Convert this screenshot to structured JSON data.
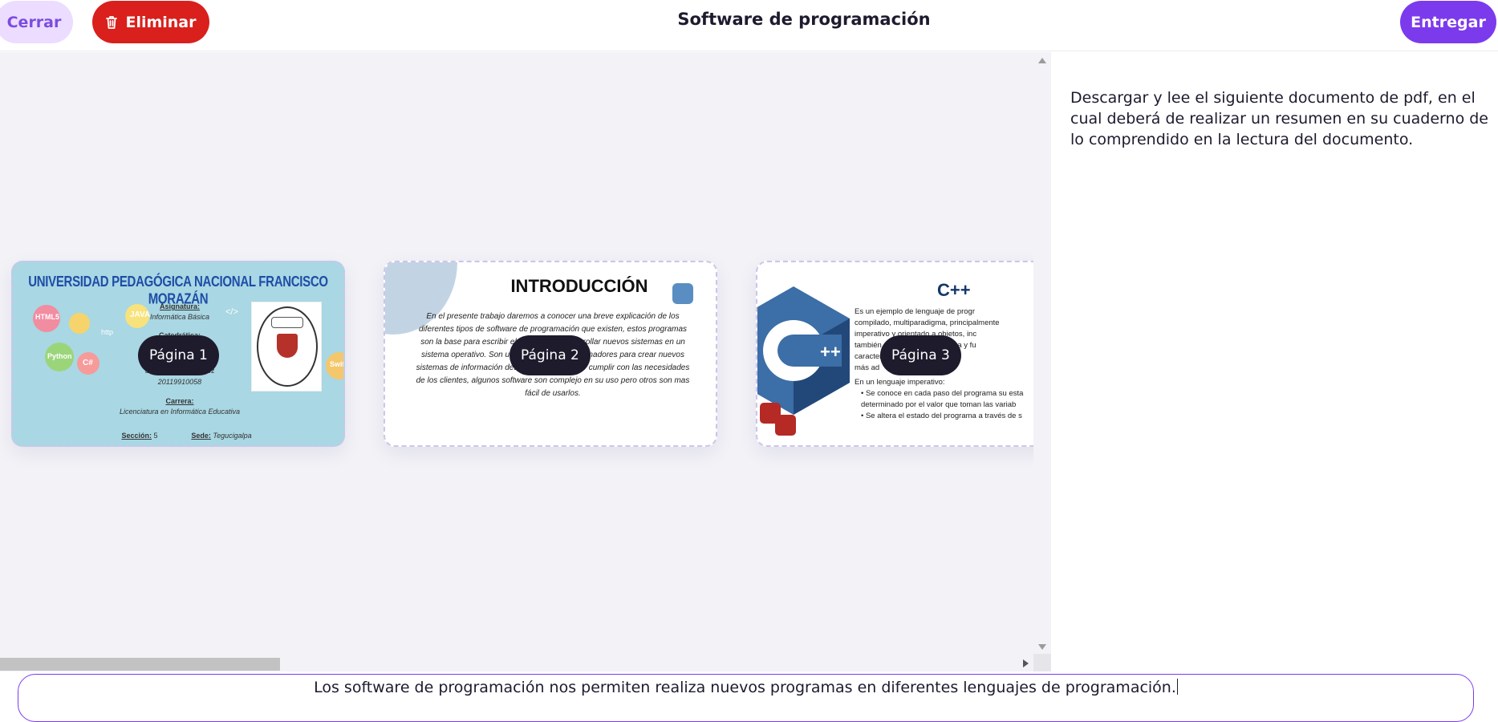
{
  "header": {
    "close_label": "Cerrar",
    "delete_label": "Eliminar",
    "title": "Software de programación",
    "submit_label": "Entregar"
  },
  "pages": [
    {
      "label": "Página 1",
      "thumbnail": {
        "university": "UNIVERSIDAD PEDAGÓGICA NACIONAL FRANCISCO MORAZÁN",
        "subject_label": "Asignatura:",
        "subject": "Informática Básica",
        "professor_label": "Catedrática:",
        "student": "Samuel ... Hernández",
        "account": "20119910058",
        "career_label": "Carrera:",
        "career": "Licenciatura en Informática Educativa",
        "section_label": "Sección:",
        "section": "5",
        "campus_label": "Sede:",
        "campus": "Tegucigalpa",
        "bubble_words": [
          "HTML5",
          "JAVA",
          "Python",
          "C#",
          "Swift",
          "http",
          "</>"
        ]
      }
    },
    {
      "label": "Página 2",
      "thumbnail": {
        "heading": "INTRODUCCIÓN",
        "body": "En el presente trabajo daremos a conocer una breve explicación de los diferentes tipos de software de programación que existen, estos programas son la base para escribir el código para desarrollar nuevos sistemas en un sistema operativo. Son utilizado por los programadores para crear nuevos sistemas de información desde cero y así poder cumplir con las necesidades de los clientes, algunos software son complejo en su uso pero otros son mas fácil de usarlos."
      }
    },
    {
      "label": "Página 3",
      "thumbnail": {
        "heading": "C++",
        "lines": [
          "Es un ejemplo de lenguaje de progr",
          "compilado, multiparadigma, principalmente",
          "imperativo y orientado a objetos, inc",
          "también programación genérica y fu",
          "características mas que comen",
          "más ad",
          "En un lenguaje imperativo:",
          "• Se conoce en cada paso del programa su esta",
          "  determinado por el valor que toman las variab",
          "• Se altera el estado del programa a través de s"
        ]
      }
    }
  ],
  "instructions": "Descargar y lee el siguiente documento de pdf, en el cual deberá de realizar un resumen en su cuaderno de lo comprendido en la lectura del documento.",
  "answer_text": "Los software de programación nos permiten realiza nuevos programas en diferentes lenguajes de programación.",
  "colors": {
    "accent": "#7c3aed",
    "delete": "#d9201c",
    "close_bg": "#ecdcff",
    "pill": "#1e1b2d"
  }
}
